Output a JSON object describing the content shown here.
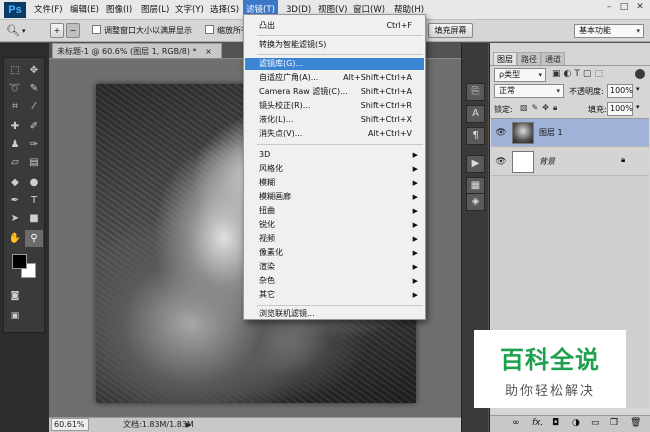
{
  "app": {
    "logo": "Ps"
  },
  "menubar": {
    "items": [
      "文件(F)",
      "编辑(E)",
      "图像(I)",
      "图层(L)",
      "文字(Y)",
      "选择(S)",
      "滤镜(T)",
      "3D(D)",
      "视图(V)",
      "窗口(W)",
      "帮助(H)"
    ],
    "active_index": 6,
    "window_controls": [
      "–",
      "□",
      "✕"
    ]
  },
  "optbar": {
    "zoom_tool_icon": "magnifier-icon",
    "resize_windows_label": "调整窗口大小以满屏显示",
    "zoom_all_label": "缩放所有",
    "fill_screen_label": "填充屏幕",
    "workspace": "基本功能"
  },
  "document": {
    "tab_title": "未标题-1 @ 60.6% (图层 1, RGB/8) *",
    "close": "×",
    "zoom": "60.61%",
    "doc_info": "文档:1.83M/1.83M"
  },
  "filter_menu": {
    "items": [
      {
        "label": "凸出",
        "shortcut": "Ctrl+F"
      },
      {
        "label": "转换为智能滤镜(S)",
        "shortcut": ""
      },
      {
        "label": "滤镜库(G)...",
        "shortcut": ""
      },
      {
        "label": "自适应广角(A)...",
        "shortcut": "Alt+Shift+Ctrl+A"
      },
      {
        "label": "Camera Raw 滤镜(C)...",
        "shortcut": "Shift+Ctrl+A"
      },
      {
        "label": "镜头校正(R)...",
        "shortcut": "Shift+Ctrl+R"
      },
      {
        "label": "液化(L)...",
        "shortcut": "Shift+Ctrl+X"
      },
      {
        "label": "消失点(V)...",
        "shortcut": "Alt+Ctrl+V"
      },
      {
        "label": "3D",
        "submenu": true
      },
      {
        "label": "风格化",
        "submenu": true
      },
      {
        "label": "模糊",
        "submenu": true
      },
      {
        "label": "模糊画廊",
        "submenu": true
      },
      {
        "label": "扭曲",
        "submenu": true
      },
      {
        "label": "锐化",
        "submenu": true
      },
      {
        "label": "视频",
        "submenu": true
      },
      {
        "label": "像素化",
        "submenu": true
      },
      {
        "label": "渲染",
        "submenu": true
      },
      {
        "label": "杂色",
        "submenu": true
      },
      {
        "label": "其它",
        "submenu": true
      },
      {
        "label": "浏览联机滤镜...",
        "shortcut": ""
      }
    ],
    "highlighted_index": 2,
    "submenu_arrow": "▶"
  },
  "layers_panel": {
    "tabs": [
      "图层",
      "路径",
      "通道"
    ],
    "active_tab": 0,
    "kind_filter": "ρ类型",
    "blend_mode": "正常",
    "opacity_label": "不透明度:",
    "opacity_value": "100%",
    "lock_label": "锁定:",
    "fill_label": "填充:",
    "fill_value": "100%",
    "layers": [
      {
        "name": "图层 1",
        "selected": true,
        "locked": false
      },
      {
        "name": "背景",
        "selected": false,
        "locked": true
      }
    ],
    "footer_icons": [
      "link-icon",
      "fx-icon",
      "mask-icon",
      "adjustment-icon",
      "group-icon",
      "new-layer-icon",
      "trash-icon"
    ],
    "fx_label": "fx."
  },
  "watermark": {
    "title": "百科全说",
    "subtitle": "助你轻松解决"
  },
  "colors": {
    "menu_highlight": "#3c84d4",
    "watermark_green": "#1ea14e",
    "selected_layer": "#9fb3d8"
  }
}
